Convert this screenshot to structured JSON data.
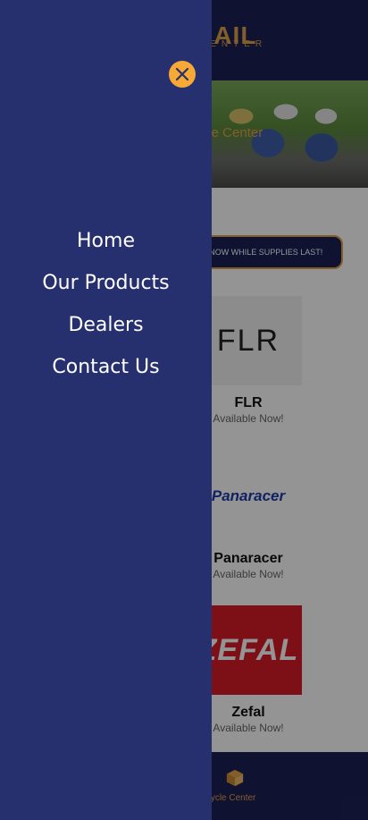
{
  "header": {
    "logo_main": "TRAIL",
    "logo_sub": "CENTER"
  },
  "hero": {
    "caption": "l Cycle Center"
  },
  "promo": {
    "button_label": "DER NOW WHILE SUPPLIES LAST!"
  },
  "brands": [
    {
      "logo_text": "FLR",
      "name": "FLR",
      "status": "Available Now!"
    },
    {
      "logo_text": "Panaracer",
      "name": "Panaracer",
      "status": "Available Now!"
    },
    {
      "logo_text": "ZEFAL",
      "name": "Zefal",
      "status": "Available Now!"
    }
  ],
  "bottom_nav": {
    "label": "l Cycle Center",
    "icon": "box-icon"
  },
  "drawer": {
    "close_icon": "close-icon",
    "menu": [
      {
        "label": "Home"
      },
      {
        "label": "Our Products"
      },
      {
        "label": "Dealers"
      },
      {
        "label": "Contact Us"
      }
    ]
  },
  "colors": {
    "navy": "#1c2057",
    "drawer": "#27306e",
    "accent": "#f6a935",
    "gold": "#e0a247",
    "zefal_red": "#d81d28"
  }
}
